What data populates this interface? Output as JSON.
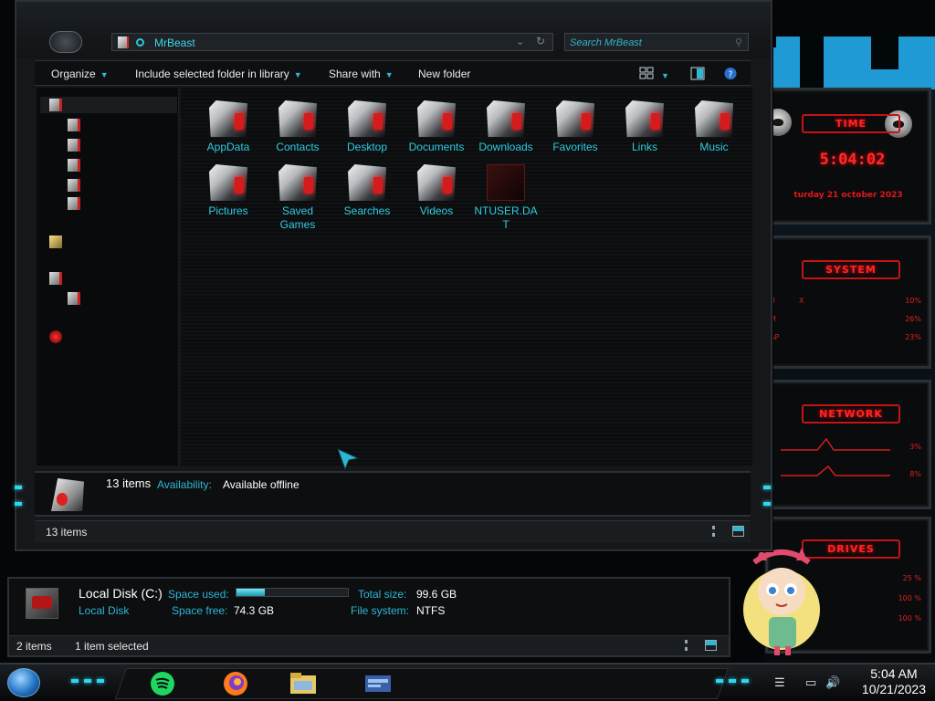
{
  "explorer": {
    "address": "MrBeast",
    "search_placeholder": "Search MrBeast",
    "toolbar": {
      "organize": "Organize",
      "include_library": "Include selected folder in library",
      "share_with": "Share with",
      "new_folder": "New folder"
    },
    "items": [
      {
        "label": "AppData",
        "icon": "appdata-folder-icon"
      },
      {
        "label": "Contacts",
        "icon": "contacts-folder-icon"
      },
      {
        "label": "Desktop",
        "icon": "desktop-folder-icon"
      },
      {
        "label": "Documents",
        "icon": "documents-folder-icon"
      },
      {
        "label": "Downloads",
        "icon": "downloads-folder-icon"
      },
      {
        "label": "Favorites",
        "icon": "favorites-folder-icon"
      },
      {
        "label": "Links",
        "icon": "links-folder-icon"
      },
      {
        "label": "Music",
        "icon": "music-folder-icon"
      },
      {
        "label": "Pictures",
        "icon": "pictures-folder-icon"
      },
      {
        "label": "Saved\nGames",
        "icon": "saved-games-folder-icon"
      },
      {
        "label": "Searches",
        "icon": "searches-folder-icon"
      },
      {
        "label": "Videos",
        "icon": "videos-folder-icon"
      },
      {
        "label": "NTUSER.DA\nT",
        "icon": "file-icon"
      }
    ],
    "details": {
      "count": "13 items",
      "availability_label": "Availability:",
      "availability_value": "Available offline"
    },
    "status": "13 items"
  },
  "drive_window": {
    "title": "Local Disk (C:)",
    "subtitle": "Local Disk",
    "space_used_label": "Space used:",
    "space_used_fraction": 0.25,
    "space_free_label": "Space free:",
    "space_free_value": "74.3 GB",
    "total_size_label": "Total size:",
    "total_size_value": "99.6 GB",
    "file_system_label": "File system:",
    "file_system_value": "NTFS",
    "status_items": "2 items",
    "status_selected": "1 item selected"
  },
  "gadgets": {
    "time_title": "TIME",
    "time_value": "5:04:02",
    "date_value": "turday 21 october 2023",
    "system_title": "SYSTEM",
    "system_rows": [
      {
        "label": "U",
        "mid": "X",
        "value": "10%"
      },
      {
        "label": "M",
        "mid": "",
        "value": "26%"
      },
      {
        "label": "AP",
        "mid": "",
        "value": "23%"
      }
    ],
    "network_title": "NETWORK",
    "network_rows": [
      {
        "value": "3%"
      },
      {
        "value": "8%"
      }
    ],
    "drives_title": "DRIVES",
    "drives_rows": [
      {
        "value": "25 %"
      },
      {
        "value": "100 %"
      },
      {
        "value": "100 %"
      }
    ]
  },
  "taskbar": {
    "time": "5:04 AM",
    "date": "10/21/2023",
    "apps": [
      "spotify-icon",
      "firefox-icon",
      "file-explorer-icon",
      "control-panel-icon"
    ]
  },
  "colors": {
    "accent_cyan": "#2fcbe0",
    "accent_red": "#ff2626",
    "teal_banner": "#1f9ad4"
  }
}
